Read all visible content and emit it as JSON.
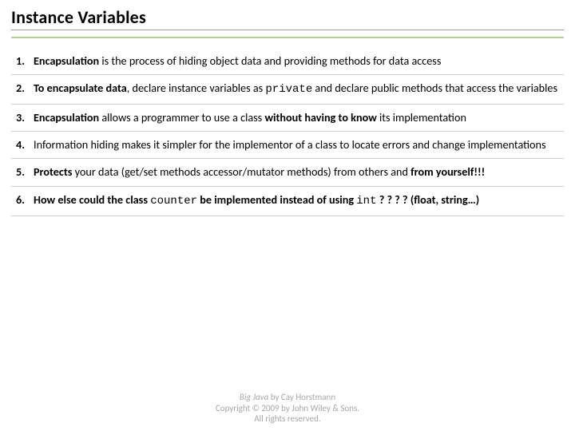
{
  "title": "Instance Variables",
  "items": [
    {
      "num": "1.",
      "html": "<span class='b'>Encapsulation</span> is the process of hiding object data and providing methods for data access"
    },
    {
      "num": "2.",
      "html": "<span class='b'>To encapsulate data</span>, declare instance variables as <span class='code'>private</span> and declare public methods that access the variables"
    },
    {
      "num": "3.",
      "html": "<span class='b'>Encapsulation</span> allows a programmer to use a class <span class='b'>without having to know</span> its implementation"
    },
    {
      "num": "4.",
      "html": "Information hiding makes it simpler for the implementor of a class to locate errors and change implementations"
    },
    {
      "num": "5.",
      "html": "<span class='b'>Protects</span> your data (get/set methods accessor/mutator methods) from others and <span class='b'>from yourself!!!</span>"
    },
    {
      "num": "6.",
      "html": "<span class='b'>How else could the class </span><span class='code'>counter</span><span class='b'> be implemented instead of using </span><span class='code'>int</span><span class='b'> ? ? ? ? (float, string…)</span>"
    }
  ],
  "footer": {
    "book": "Big Java",
    "byline": " by Cay Horstmann",
    "copyright": "Copyright © 2009 by John Wiley & Sons.",
    "rights": "All rights reserved."
  }
}
